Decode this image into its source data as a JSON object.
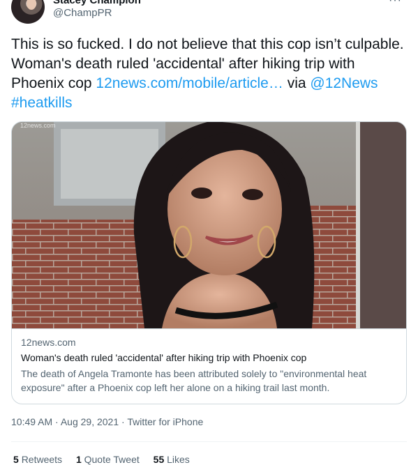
{
  "author": {
    "name": "Stacey Champion",
    "handle": "@ChampPR"
  },
  "tweet": {
    "text": "This is so fucked. I do not believe that this cop isn’t culpable. Woman's death ruled 'accidental' after hiking trip with Phoenix cop ",
    "link": "12news.com/mobile/article…",
    "via": " via ",
    "mention": "@12News",
    "hashtag": "#heatkills"
  },
  "card": {
    "watermark": "12news.com",
    "domain": "12news.com",
    "title": "Woman's death ruled 'accidental' after hiking trip with Phoenix cop",
    "description": "The death of Angela Tramonte has been attributed solely to \"environmental heat exposure\" after a Phoenix cop left her alone on a hiking trail last month."
  },
  "meta": {
    "time": "10:49 AM",
    "separator": " · ",
    "date": "Aug 29, 2021",
    "source": "Twitter for iPhone"
  },
  "stats": {
    "retweets_count": "5",
    "retweets_label": "Retweets",
    "quotes_count": "1",
    "quotes_label": "Quote Tweet",
    "likes_count": "55",
    "likes_label": "Likes"
  },
  "icons": {
    "more": "more-icon"
  }
}
